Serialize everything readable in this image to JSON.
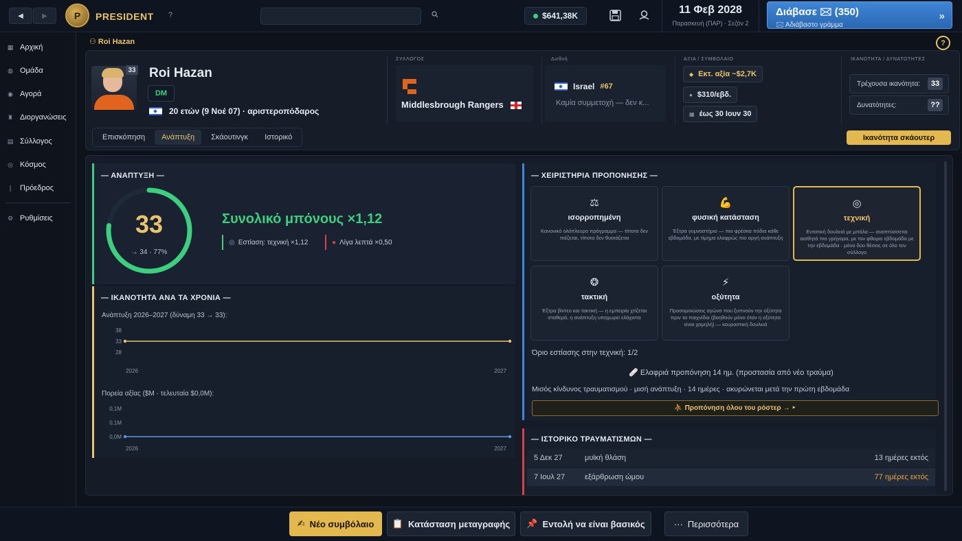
{
  "topbar": {
    "back": "◀",
    "forward": "▶",
    "logo_letter": "P",
    "brand": "PRESIDENT",
    "help": "?",
    "search_icon": "search-icon",
    "money": "$641,38K",
    "date": "11 Φεβ 2028",
    "season": "Παρασκευή (ΠΑΡ) · Σεζόν 2",
    "mail_title": "Διάβασε 🖂 (350)",
    "mail_sub": "🖂 Αδιάβαστο γράμμα",
    "mail_arrow": "»"
  },
  "sidebar": {
    "items": [
      {
        "icon": "home-icon",
        "label": "Αρχική"
      },
      {
        "icon": "team-icon",
        "label": "Ομάδα"
      },
      {
        "icon": "market-icon",
        "label": "Αγορά"
      },
      {
        "icon": "trophy-icon",
        "label": "Διοργανώσεις"
      },
      {
        "icon": "club-icon",
        "label": "Σύλλογος"
      },
      {
        "icon": "globe-icon",
        "label": "Κόσμος"
      },
      {
        "icon": "president-icon",
        "label": "Πρόεδρος"
      },
      {
        "icon": "settings-icon",
        "label": "Ρυθμίσεις"
      }
    ]
  },
  "breadcrumb": "Roi Hazan",
  "help_button": "?",
  "player": {
    "number": "33",
    "name": "Roi Hazan",
    "position": "DM",
    "info": "20 ετών (9 Νοέ 07) · αριστεροπόδαρος",
    "club_header": "ΣΥΛΛΟΓΟΣ",
    "club": "Middlesbrough Rangers",
    "intl_header": "Διεθνή",
    "nation": "Israel",
    "nation_rank": "#67",
    "intl_none": "Καμία συμμετοχή — δεν κ...",
    "value_header": "ΑΞΙΑ / ΣΥΜΒΟΛΑΙΟ",
    "est_value": "Εκτ. αξία ~$2,7K",
    "wage": "$310/εβδ.",
    "contract": "έως 30 Ιουν 30",
    "ability_header": "ΙΚΑΝΟΤΗΤΑ / ΔΥΝΑΤΟΤΗΤΕΣ",
    "current_label": "Τρέχουσα ικανότητα:",
    "current_value": "33",
    "potential_label": "Δυνατότητες:",
    "potential_value": "??"
  },
  "tabs": [
    "Επισκόπηση",
    "Ανάπτυξη",
    "Σκάουτινγκ",
    "Ιστορικό"
  ],
  "active_tab": 1,
  "scout_button": "Ικανότητα σκάουτερ",
  "development": {
    "title": "— ΑΝΑΠΤΥΞΗ —",
    "ability": "33",
    "ring_fraction": 0.77,
    "projection": "→ 34 · 77%",
    "bonus": "Συνολικό μπόνους ×1,12",
    "focus": "Εστίαση: τεχνική ×1,12",
    "minutes": "Λίγα λεπτά ×0,50"
  },
  "ability_years": {
    "title": "— ΙΚΑΝΟΤΗΤΑ ΑΝΑ ΤΑ ΧΡΟΝΙΑ —",
    "dev_label": "Ανάπτυξη 2026–2027 (δύναμη 33 → 33):",
    "value_label": "Πορεία αξίας ($M · τελευταία $0,0M):"
  },
  "chart_data": [
    {
      "type": "line",
      "x": [
        "2026",
        "2027"
      ],
      "series": [
        {
          "values": [
            33,
            33
          ],
          "color": "#e9c46a"
        }
      ],
      "yticks": [
        "38",
        "33",
        "28"
      ],
      "ylim": [
        28,
        38
      ]
    },
    {
      "type": "line",
      "x": [
        "2026",
        "2027"
      ],
      "series": [
        {
          "values": [
            0.0,
            0.0
          ],
          "color": "#5b9ae3"
        }
      ],
      "yticks": [
        "0,1M",
        "0,1M",
        "0,0M"
      ],
      "ylim": [
        0,
        0.1
      ]
    }
  ],
  "training": {
    "title": "— ΧΕΙΡΙΣΤΗΡΙΑ ΠΡΟΠΟΝΗΣΗΣ —",
    "cards": [
      {
        "icon": "balance-icon",
        "glyph": "⚖",
        "title": "ισορροπημένη",
        "desc": "Κανονικό ολόπλευρο πρόγραμμα — τίποτα δεν πιέζεται, τίποτα δεν θυσιάζεται"
      },
      {
        "icon": "muscle-icon",
        "glyph": "💪",
        "title": "φυσική κατάσταση",
        "desc": "Έξτρα γυμναστήριο — πιο φρέσκα πόδια κάθε εβδομάδα, με τίμημα ελαφρώς πιο αργή ανάπτυξη"
      },
      {
        "icon": "target-icon",
        "glyph": "◎",
        "title": "τεχνική",
        "desc": "Εντατική δουλειά με μπάλα — αναπτύσσεται αισθητά πιο γρήγορα, με τον φθειρει εβδομάδα με την εβδομάδα · μόνο δύο θέσεις σε όλο τον σύλλογο"
      },
      {
        "icon": "brain-icon",
        "glyph": "❂",
        "title": "τακτική",
        "desc": "Έξτρα βίντεο και τακτική — η εμπειρία χτίζεται σταθερά, η ανάπτυξη υποχωρεί ελάχιστα"
      },
      {
        "icon": "lightning-icon",
        "glyph": "⚡",
        "title": "οξύτητα",
        "desc": "Προσομοιώσεις αγώνα που ξυπνούν την οξύτητα πριν τα παιχνίδια (βοηθούν μόνο όταν η οξύτητα είναι χαμηλή) — κουραστική δουλειά"
      }
    ],
    "selected": 2,
    "focus_limit": "Όριο εστίασης στην τεχνική: 1/2",
    "light_training": "🩹 Ελαφριά προπόνηση 14 ημ. (προστασία από νέο τραύμα)",
    "risk": "Μισός κίνδυνος τραυματισμού · μισή ανάπτυξη · 14 ημέρες · ακυρώνεται μετά την πρώτη εβδομάδα",
    "roster_button": "⛹ Προπόνηση όλου του ρόστερ → ‣"
  },
  "injuries": {
    "title": "— ΙΣΤΟΡΙΚΟ ΤΡΑΥΜΑΤΙΣΜΩΝ —",
    "rows": [
      {
        "date": "5 Δεκ 27",
        "type": "μυϊκή θλάση",
        "days": "13 ημέρες εκτός",
        "color": "#c3cbd6"
      },
      {
        "date": "7 Ιουλ 27",
        "type": "εξάρθρωση ώμου",
        "days": "77 ημέρες εκτός",
        "color": "#e9a23b"
      }
    ]
  },
  "actions": {
    "new_contract": "Νέο συμβόλαιο",
    "transfer_status": "Κατάσταση μεταγραφής",
    "starter_order": "Εντολή να είναι βασικός",
    "more": "Περισσότερα"
  }
}
